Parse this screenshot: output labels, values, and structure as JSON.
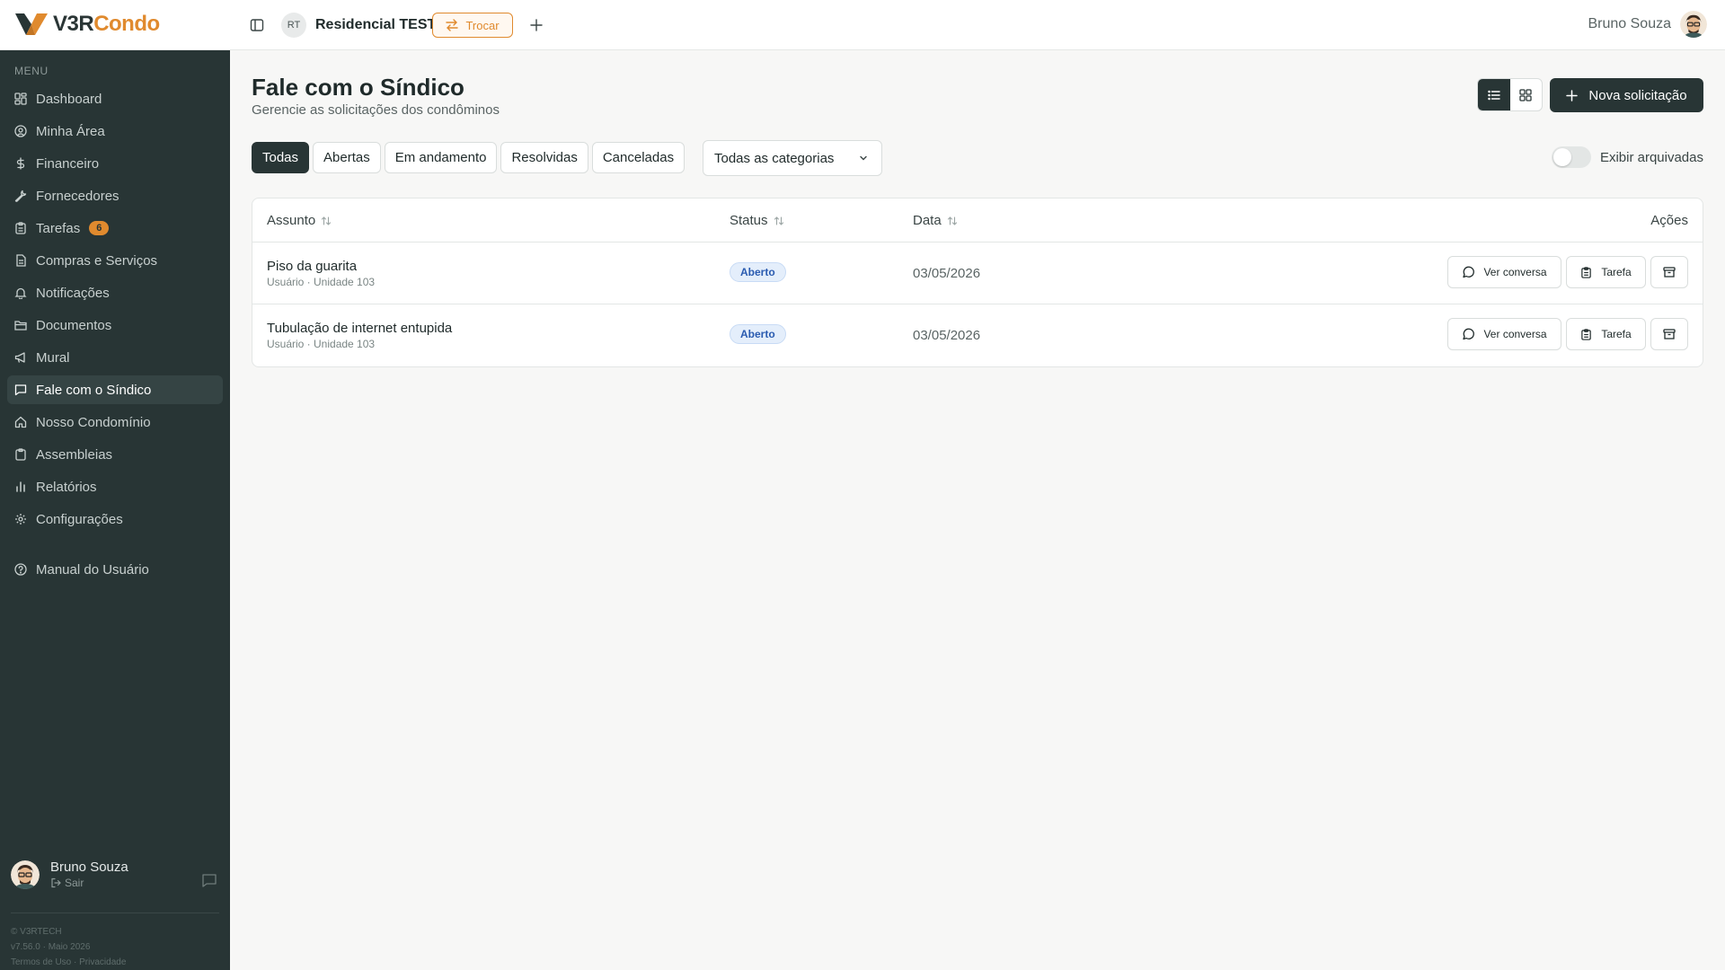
{
  "brand": {
    "logo_part1": "V3R",
    "logo_part2": "Condo",
    "accent_color": "#e08a2e",
    "dark_color": "#283535"
  },
  "header": {
    "condo_initials": "RT",
    "condo_name": "Residencial TESTE",
    "switch_label": "Trocar",
    "user_name": "Bruno Souza"
  },
  "sidebar": {
    "menu_label": "MENU",
    "items": [
      {
        "label": "Dashboard",
        "icon": "dashboard-icon"
      },
      {
        "label": "Minha Área",
        "icon": "user-circle-icon"
      },
      {
        "label": "Financeiro",
        "icon": "dollar-icon"
      },
      {
        "label": "Fornecedores",
        "icon": "wrench-icon"
      },
      {
        "label": "Tarefas",
        "icon": "clipboard-icon",
        "badge": "6"
      },
      {
        "label": "Compras e Serviços",
        "icon": "document-icon"
      },
      {
        "label": "Notificações",
        "icon": "bell-icon"
      },
      {
        "label": "Documentos",
        "icon": "folder-icon"
      },
      {
        "label": "Mural",
        "icon": "megaphone-icon"
      },
      {
        "label": "Fale com o Síndico",
        "icon": "chat-icon",
        "active": true
      },
      {
        "label": "Nosso Condomínio",
        "icon": "home-icon"
      },
      {
        "label": "Assembleias",
        "icon": "clipboard-icon"
      },
      {
        "label": "Relatórios",
        "icon": "bar-chart-icon"
      },
      {
        "label": "Configurações",
        "icon": "gear-icon"
      }
    ],
    "help": {
      "label": "Manual do Usuário",
      "icon": "help-icon"
    },
    "footer": {
      "user_name": "Bruno Souza",
      "logout_label": "Sair",
      "copyright": "© V3RTECH",
      "version": "v7.56.0 · Maio 2026",
      "terms": "Termos de Uso",
      "privacy": "Privacidade"
    }
  },
  "main": {
    "title": "Fale com o Síndico",
    "subtitle": "Gerencie as solicitações dos condôminos",
    "new_button": "Nova solicitação",
    "tabs": [
      {
        "label": "Todas",
        "active": true
      },
      {
        "label": "Abertas"
      },
      {
        "label": "Em andamento"
      },
      {
        "label": "Resolvidas"
      },
      {
        "label": "Canceladas"
      }
    ],
    "category_select": "Todas as categorias",
    "archived_label": "Exibir arquivadas",
    "archived_on": false,
    "table": {
      "columns": {
        "subject": "Assunto",
        "status": "Status",
        "date": "Data",
        "actions": "Ações"
      },
      "rows": [
        {
          "subject": "Piso da guarita",
          "meta": "Usuário · Unidade 103",
          "status": "Aberto",
          "date": "03/05/2026",
          "view_label": "Ver conversa",
          "task_label": "Tarefa"
        },
        {
          "subject": "Tubulação de internet entupida",
          "meta": "Usuário · Unidade 103",
          "status": "Aberto",
          "date": "03/05/2026",
          "view_label": "Ver conversa",
          "task_label": "Tarefa"
        }
      ]
    }
  }
}
